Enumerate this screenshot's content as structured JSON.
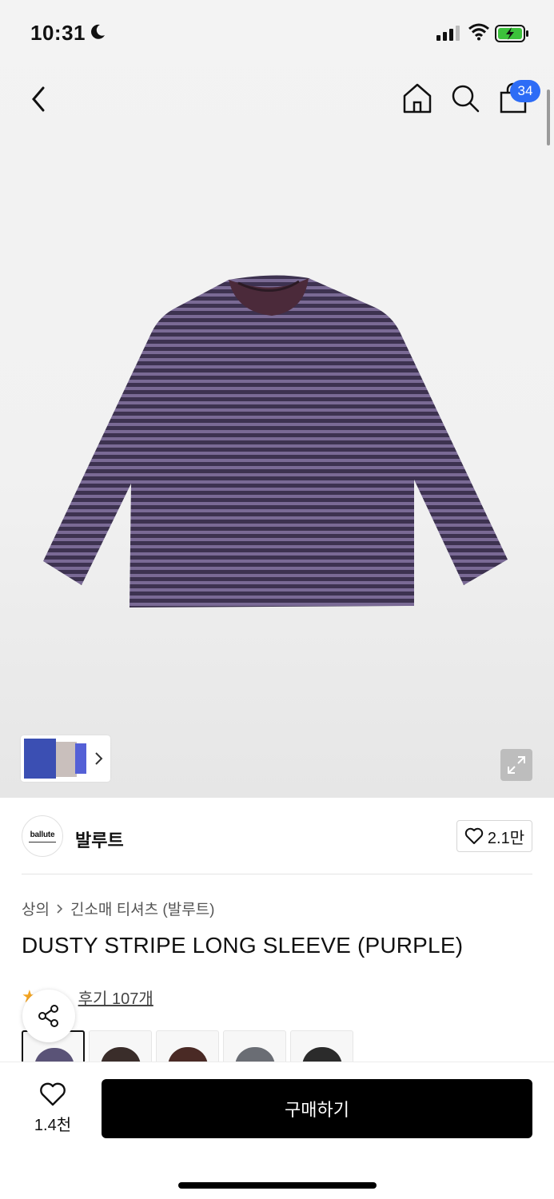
{
  "status_bar": {
    "time": "10:31"
  },
  "nav": {
    "cart_count": "34"
  },
  "brand": {
    "logo_text": "ballute",
    "name": "발루트",
    "likes": "2.1만"
  },
  "breadcrumb": {
    "category": "상의",
    "subcategory": "긴소매 티셔츠 (발루트)"
  },
  "product": {
    "title": "DUSTY STRIPE LONG SLEEVE (PURPLE)"
  },
  "rating": {
    "review_label": "후기 107개"
  },
  "color_options": [
    {
      "color": "#5a5377"
    },
    {
      "color": "#3a2d2a"
    },
    {
      "color": "#4a2a25"
    },
    {
      "color": "#6a6d74"
    },
    {
      "color": "#2b2b2b"
    }
  ],
  "bottom_bar": {
    "like_count": "1.4천",
    "buy_label": "구매하기"
  },
  "colors": {
    "accent_badge": "#2d6cf6",
    "battery_green": "#3cc13b",
    "buy_button": "#000000"
  }
}
